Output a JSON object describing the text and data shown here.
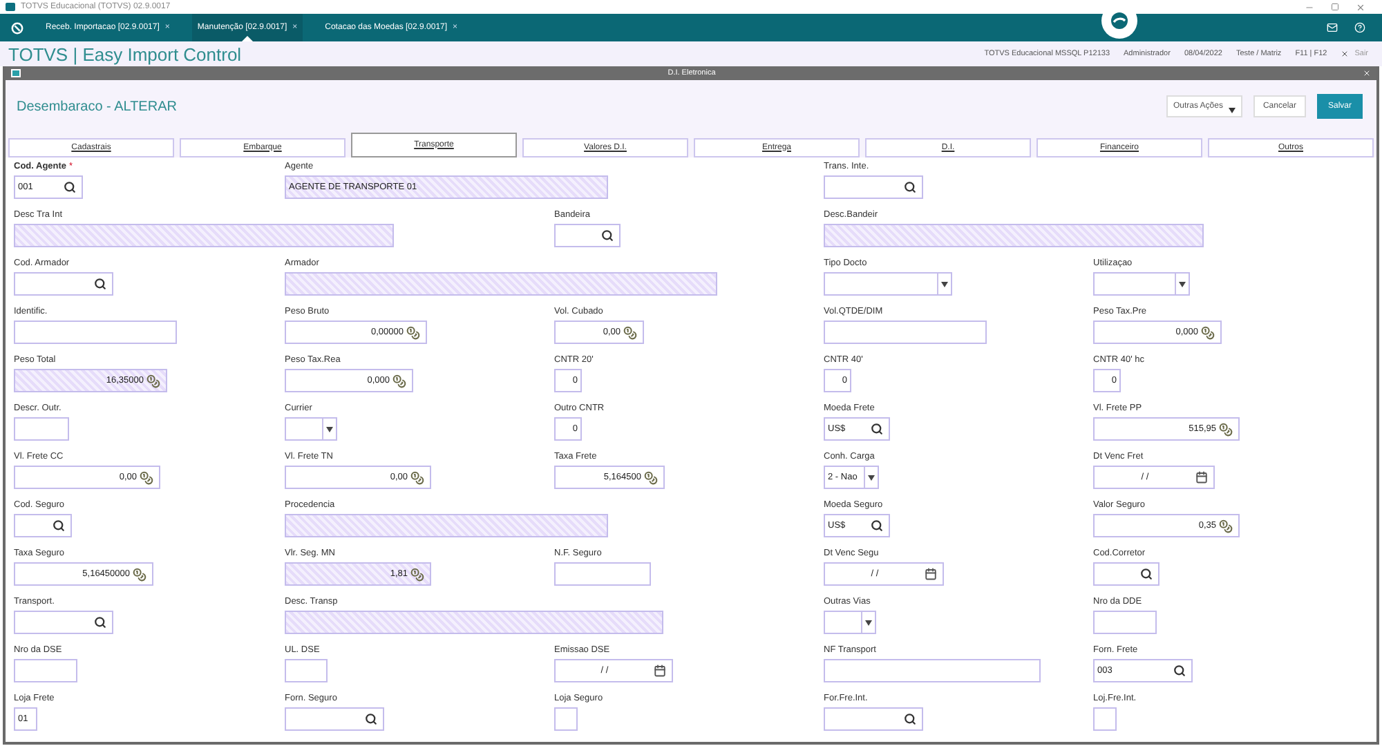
{
  "window": {
    "title": "TOTVS Educacional (TOTVS) 02.9.0017"
  },
  "app_tabs": [
    {
      "label": "Receb. Importacao [02.9.0017]",
      "close": "×",
      "selected": false
    },
    {
      "label": "Manutenção [02.9.0017]",
      "close": "×",
      "selected": true
    },
    {
      "label": "Cotacao das Moedas [02.9.0017]",
      "close": "×",
      "selected": false
    }
  ],
  "header": {
    "title": "TOTVS | Easy Import Control",
    "info": [
      "TOTVS Educacional MSSQL P12133",
      "Administrador",
      "08/04/2022",
      "Teste / Matriz",
      "F11 | F12"
    ],
    "exit": "Sair"
  },
  "dialog": {
    "title": "D.I. Eletronica",
    "heading": "Desembaraco - ALTERAR",
    "actions": [
      {
        "label": "Outras Ações",
        "kind": "menu"
      },
      {
        "label": "Cancelar",
        "kind": "secondary"
      },
      {
        "label": "Salvar",
        "kind": "primary"
      }
    ]
  },
  "tabs": [
    {
      "label": "Cadastrais",
      "selected": false
    },
    {
      "label": "Embarque",
      "selected": false
    },
    {
      "label": "Transporte",
      "selected": true
    },
    {
      "label": "Valores D.I.",
      "selected": false
    },
    {
      "label": "Entrega",
      "selected": false
    },
    {
      "label": "D.I.",
      "selected": false
    },
    {
      "label": "Financeiro",
      "selected": false
    },
    {
      "label": "Outros",
      "selected": false
    }
  ],
  "form": {
    "required_mark": "*",
    "rows": [
      [
        {
          "label": "Cod. Agente",
          "required": true,
          "kind": "lookup",
          "readonly": false,
          "value": "001"
        },
        {
          "label": "Agente",
          "required": false,
          "kind": "text",
          "readonly": true,
          "value": "AGENTE DE TRANSPORTE 01"
        },
        null,
        {
          "label": "Trans. Inte.",
          "required": false,
          "kind": "lookup",
          "readonly": false
        },
        null
      ],
      [
        {
          "label": "Desc Tra Int",
          "required": false,
          "kind": "text",
          "readonly": true
        },
        null,
        {
          "label": "Bandeira",
          "required": false,
          "kind": "lookup",
          "readonly": false
        },
        {
          "label": "Desc.Bandeir",
          "required": false,
          "kind": "text",
          "readonly": true
        },
        null
      ],
      [
        {
          "label": "Cod. Armador",
          "required": false,
          "kind": "lookup",
          "readonly": false
        },
        {
          "label": "Armador",
          "required": false,
          "kind": "text",
          "readonly": true
        },
        null,
        {
          "label": "Tipo Docto",
          "required": false,
          "kind": "select",
          "readonly": false
        },
        {
          "label": "Utilizaçao",
          "required": false,
          "kind": "select",
          "readonly": false
        }
      ],
      [
        {
          "label": "Identific.",
          "required": false,
          "kind": "text",
          "readonly": false
        },
        {
          "label": "Peso Bruto",
          "required": false,
          "kind": "number",
          "readonly": false,
          "value": "0,00000"
        },
        {
          "label": "Vol. Cubado",
          "required": false,
          "kind": "number",
          "readonly": false,
          "value": "0,00"
        },
        {
          "label": "Vol.QTDE/DIM",
          "required": false,
          "kind": "text",
          "readonly": false
        },
        {
          "label": "Peso Tax.Pre",
          "required": false,
          "kind": "number",
          "readonly": false,
          "value": "0,000"
        }
      ],
      [
        {
          "label": "Peso Total",
          "required": false,
          "kind": "number",
          "readonly": true,
          "value": "16,35000"
        },
        {
          "label": "Peso Tax.Rea",
          "required": false,
          "kind": "number",
          "readonly": false,
          "value": "0,000"
        },
        {
          "label": "CNTR 20'",
          "required": false,
          "kind": "count",
          "readonly": false,
          "value": "0"
        },
        {
          "label": "CNTR 40'",
          "required": false,
          "kind": "count",
          "readonly": false,
          "value": "0"
        },
        {
          "label": "CNTR 40' hc",
          "required": false,
          "kind": "count",
          "readonly": false,
          "value": "0"
        }
      ],
      [
        {
          "label": "Descr. Outr.",
          "required": false,
          "kind": "text",
          "readonly": false
        },
        {
          "label": "Currier",
          "required": false,
          "kind": "select",
          "readonly": false
        },
        {
          "label": "Outro CNTR",
          "required": false,
          "kind": "count",
          "readonly": false,
          "value": "0"
        },
        {
          "label": "Moeda Frete",
          "required": false,
          "kind": "lookup",
          "readonly": false,
          "value": "US$"
        },
        {
          "label": "Vl. Frete PP",
          "required": false,
          "kind": "number",
          "readonly": false,
          "value": "515,95"
        }
      ],
      [
        {
          "label": "Vl. Frete CC",
          "required": false,
          "kind": "number",
          "readonly": false,
          "value": "0,00"
        },
        {
          "label": "Vl. Frete TN",
          "required": false,
          "kind": "number",
          "readonly": false,
          "value": "0,00"
        },
        {
          "label": "Taxa Frete",
          "required": false,
          "kind": "number",
          "readonly": false,
          "value": "5,164500"
        },
        {
          "label": "Conh. Carga",
          "required": false,
          "kind": "select",
          "readonly": false,
          "value": "2 - Nao"
        },
        {
          "label": "Dt Venc Fret",
          "required": false,
          "kind": "date",
          "readonly": false,
          "value": "/ /"
        }
      ],
      [
        {
          "label": "Cod. Seguro",
          "required": false,
          "kind": "lookup",
          "readonly": false
        },
        {
          "label": "Procedencia",
          "required": false,
          "kind": "text",
          "readonly": true
        },
        null,
        {
          "label": "Moeda Seguro",
          "required": false,
          "kind": "lookup",
          "readonly": false,
          "value": "US$"
        },
        {
          "label": "Valor Seguro",
          "required": false,
          "kind": "number",
          "readonly": false,
          "value": "0,35"
        }
      ],
      [
        {
          "label": "Taxa Seguro",
          "required": false,
          "kind": "number",
          "readonly": false,
          "value": "5,16450000"
        },
        {
          "label": "Vlr. Seg. MN",
          "required": false,
          "kind": "number",
          "readonly": true,
          "value": "1,81"
        },
        {
          "label": "N.F. Seguro",
          "required": false,
          "kind": "text",
          "readonly": false
        },
        {
          "label": "Dt Venc Segu",
          "required": false,
          "kind": "date",
          "readonly": false,
          "value": "/ /"
        },
        {
          "label": "Cod.Corretor",
          "required": false,
          "kind": "lookup",
          "readonly": false
        }
      ],
      [
        {
          "label": "Transport.",
          "required": false,
          "kind": "lookup",
          "readonly": false
        },
        {
          "label": "Desc. Transp",
          "required": false,
          "kind": "text",
          "readonly": true
        },
        null,
        {
          "label": "Outras Vias",
          "required": false,
          "kind": "select",
          "readonly": false
        },
        {
          "label": "Nro da DDE",
          "required": false,
          "kind": "text",
          "readonly": false
        }
      ],
      [
        {
          "label": "Nro da DSE",
          "required": false,
          "kind": "text",
          "readonly": false
        },
        {
          "label": "UL. DSE",
          "required": false,
          "kind": "text",
          "readonly": false
        },
        {
          "label": "Emissao DSE",
          "required": false,
          "kind": "date",
          "readonly": false,
          "value": "/ /"
        },
        {
          "label": "NF Transport",
          "required": false,
          "kind": "text",
          "readonly": false
        },
        {
          "label": "Forn. Frete",
          "required": false,
          "kind": "lookup",
          "readonly": false,
          "value": "003"
        }
      ],
      [
        {
          "label": "Loja Frete",
          "required": false,
          "kind": "text",
          "readonly": false,
          "value": "01"
        },
        {
          "label": "Forn. Seguro",
          "required": false,
          "kind": "lookup",
          "readonly": false
        },
        {
          "label": "Loja Seguro",
          "required": false,
          "kind": "text",
          "readonly": false
        },
        {
          "label": "For.Fre.Int.",
          "required": false,
          "kind": "lookup",
          "readonly": false
        },
        {
          "label": "Loj.Fre.Int.",
          "required": false,
          "kind": "text",
          "readonly": false
        }
      ]
    ]
  }
}
